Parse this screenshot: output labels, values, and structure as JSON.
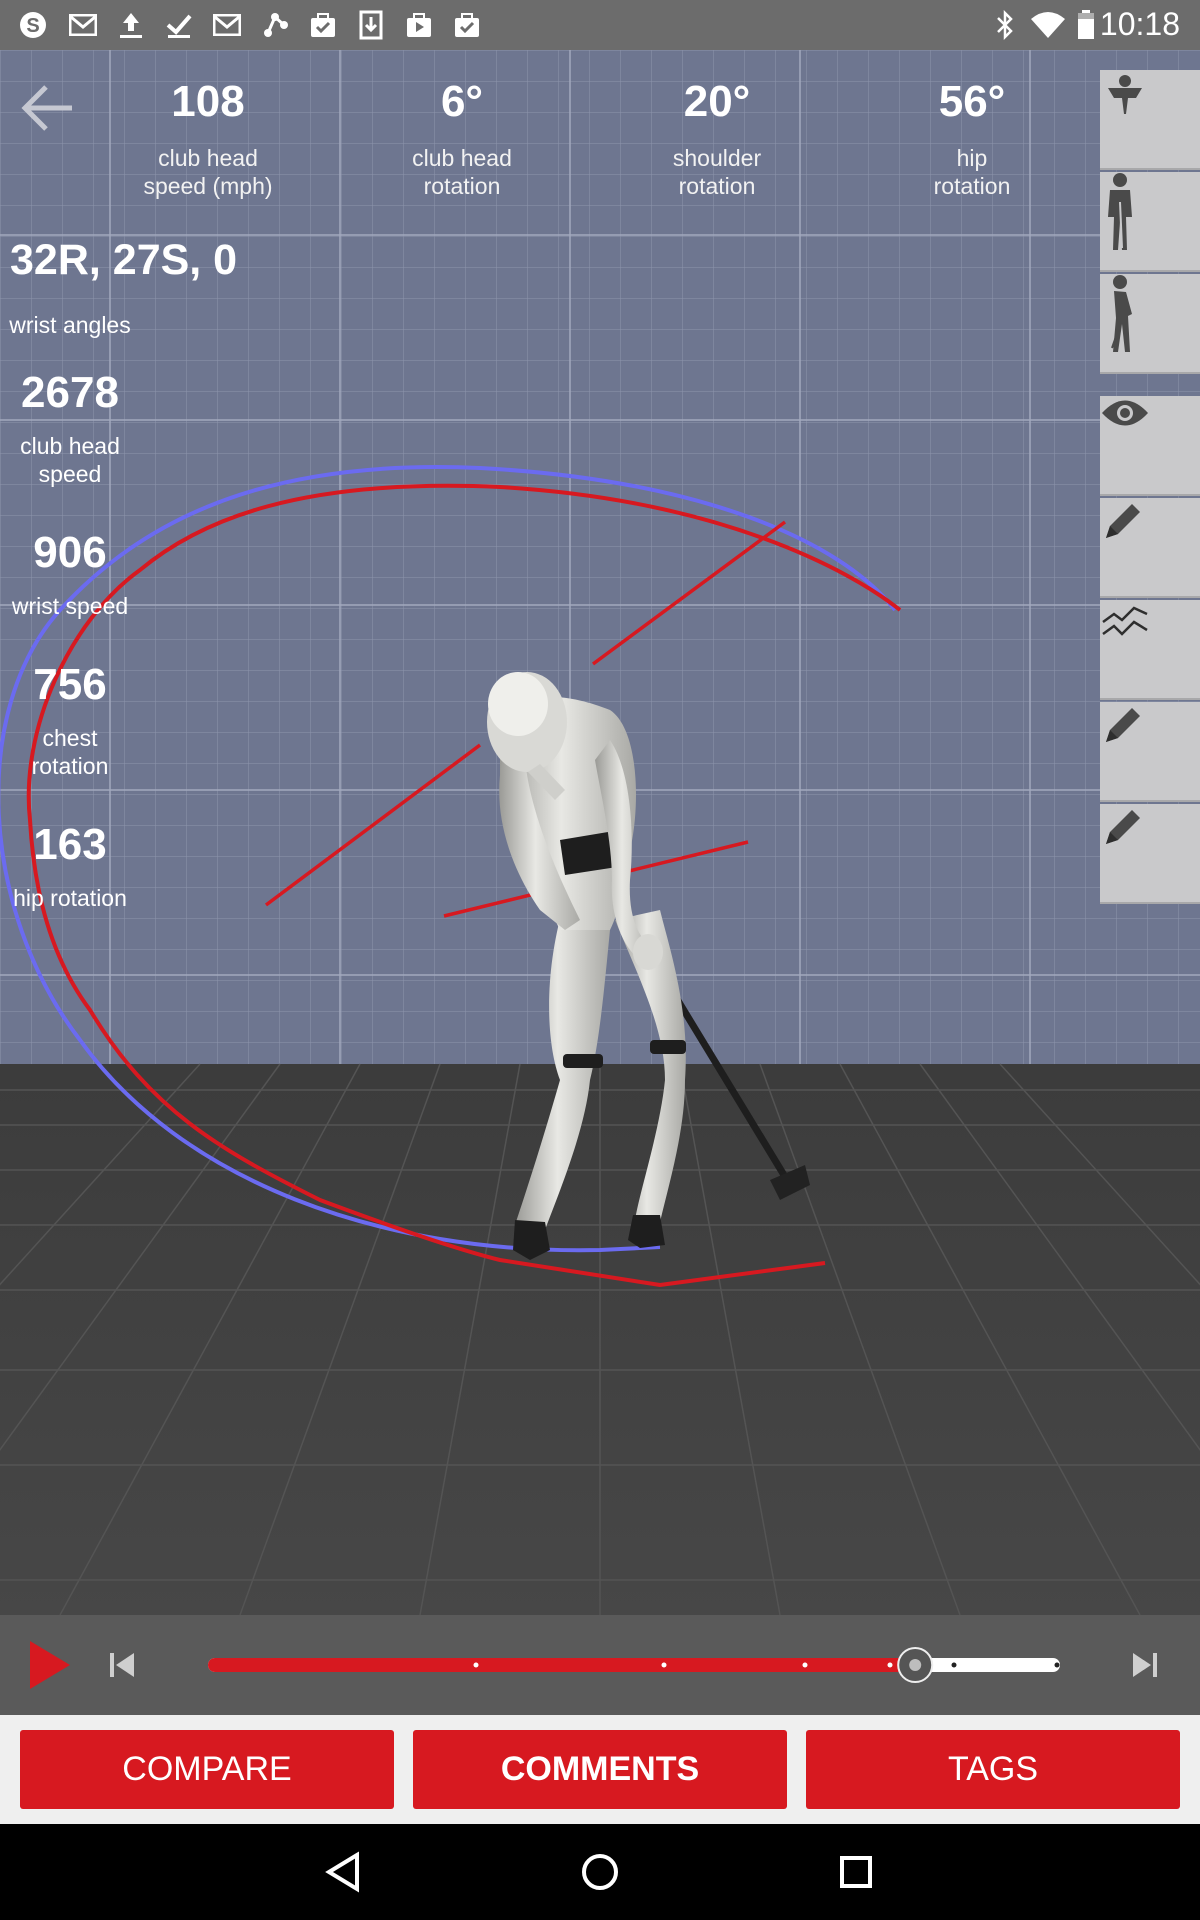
{
  "status_bar": {
    "time": "10:18",
    "left_icons": [
      "skype-icon",
      "gmail-icon",
      "upload-icon",
      "check-icon",
      "gmail-icon",
      "share-icon",
      "briefcase-check-icon",
      "download-icon",
      "play-store-icon",
      "briefcase-check-icon"
    ],
    "right_icons": [
      "bluetooth-icon",
      "wifi-icon",
      "battery-icon"
    ]
  },
  "top_metrics": [
    {
      "value": "108",
      "label": "club head\nspeed (mph)"
    },
    {
      "value": "6°",
      "label": "club head\nrotation"
    },
    {
      "value": "20°",
      "label": "shoulder\nrotation"
    },
    {
      "value": "56°",
      "label": "hip\nrotation"
    }
  ],
  "wrist": {
    "value": "32R, 27S, 0",
    "label": "wrist angles"
  },
  "left_metrics": [
    {
      "value": "2678",
      "label": "club head\nspeed"
    },
    {
      "value": "906",
      "label": "wrist speed"
    },
    {
      "value": "756",
      "label": "chest\nrotation"
    },
    {
      "value": "163",
      "label": "hip rotation"
    }
  ],
  "right_toolbar": [
    "trophy-icon",
    "golfer-front-icon",
    "golfer-side-icon",
    "eye-icon",
    "pencil-icon",
    "chart-lines-icon",
    "pencil-icon",
    "pencil-icon"
  ],
  "playback": {
    "progress": 0.83
  },
  "tabs": {
    "compare": "COMPARE",
    "comments": "COMMENTS",
    "tags": "TAGS"
  },
  "colors": {
    "accent": "#d71920",
    "blue_path": "#6b6bf0",
    "red_path": "#d71920"
  }
}
